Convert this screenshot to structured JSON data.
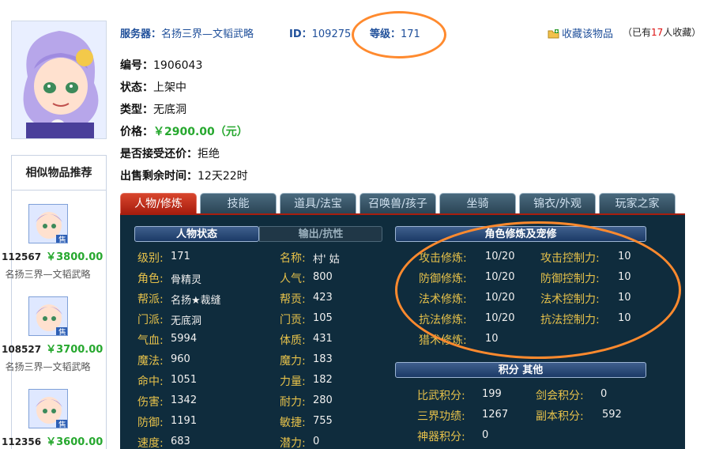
{
  "header": {
    "server_label": "服务器：",
    "server_value": "名扬三界—文韬武略",
    "id_label": "ID：",
    "id_value": "109275",
    "level_label": "等级：",
    "level_value": "171",
    "favorite_label": "收藏该物品",
    "favorite_prefix": "（已有",
    "favorite_count": "17",
    "favorite_suffix": "人收藏）"
  },
  "info": {
    "serial_label": "编号：",
    "serial_value": "1906043",
    "status_label": "状态：",
    "status_value": "上架中",
    "type_label": "类型：",
    "type_value": "无底洞",
    "price_label": "价格：",
    "price_value": "￥2900.00（元）",
    "counter_label": "是否接受还价：",
    "counter_value": "拒绝",
    "remain_label": "出售剩余时间：",
    "remain_value": "12天22时"
  },
  "similar": {
    "title": "相似物品推荐",
    "items": [
      {
        "id": "112567",
        "price": "￥3800.00",
        "server": "名扬三界—文韬武略",
        "badge": "售"
      },
      {
        "id": "108527",
        "price": "￥3700.00",
        "server": "名扬三界—文韬武略",
        "badge": "售"
      },
      {
        "id": "112356",
        "price": "￥3600.00",
        "badge": "售"
      }
    ]
  },
  "tabs": [
    "人物/修炼",
    "技能",
    "道具/法宝",
    "召唤兽/孩子",
    "坐骑",
    "锦衣/外观",
    "玩家之家"
  ],
  "panel": {
    "left_bar_active": "人物状态",
    "left_bar_inactive": "输出/抗性",
    "stats_left": [
      {
        "label": "级别:",
        "value": "171"
      },
      {
        "label": "角色:",
        "value": "骨精灵"
      },
      {
        "label": "帮派:",
        "value": "名扬★裁缝"
      },
      {
        "label": "门派:",
        "value": "无底洞"
      },
      {
        "label": "气血:",
        "value": "5994"
      },
      {
        "label": "魔法:",
        "value": "960"
      },
      {
        "label": "命中:",
        "value": "1051"
      },
      {
        "label": "伤害:",
        "value": "1342"
      },
      {
        "label": "防御:",
        "value": "1191"
      },
      {
        "label": "速度:",
        "value": "683"
      }
    ],
    "stats_right": [
      {
        "label": "名称:",
        "value": "村' 姑"
      },
      {
        "label": "人气:",
        "value": "800"
      },
      {
        "label": "帮贡:",
        "value": "423"
      },
      {
        "label": "门贡:",
        "value": "105"
      },
      {
        "label": "体质:",
        "value": "431"
      },
      {
        "label": "魔力:",
        "value": "183"
      },
      {
        "label": "力量:",
        "value": "182"
      },
      {
        "label": "耐力:",
        "value": "280"
      },
      {
        "label": "敏捷:",
        "value": "755"
      },
      {
        "label": "潜力:",
        "value": "0"
      }
    ],
    "cult_bar": "角色修炼及宠修",
    "cult_left": [
      {
        "label": "攻击修炼:",
        "value": "10/20"
      },
      {
        "label": "防御修炼:",
        "value": "10/20"
      },
      {
        "label": "法术修炼:",
        "value": "10/20"
      },
      {
        "label": "抗法修炼:",
        "value": "10/20"
      },
      {
        "label": "猎术修炼:",
        "value": "10"
      }
    ],
    "cult_right": [
      {
        "label": "攻击控制力:",
        "value": "10"
      },
      {
        "label": "防御控制力:",
        "value": "10"
      },
      {
        "label": "法术控制力:",
        "value": "10"
      },
      {
        "label": "抗法控制力:",
        "value": "10"
      }
    ],
    "score_bar": "积分 其他",
    "scores": [
      {
        "label": "比武积分:",
        "value": "199"
      },
      {
        "label": "剑会积分:",
        "value": "0"
      },
      {
        "label": "三界功绩:",
        "value": "1267"
      },
      {
        "label": "副本积分:",
        "value": "592"
      },
      {
        "label": "神器积分:",
        "value": "0"
      }
    ]
  },
  "colors": {
    "accent": "#1f4f9a",
    "price": "#27a82f",
    "panel": "#0f2c3d",
    "highlight": "#ff8a2e",
    "label_gold": "#e6c14a"
  }
}
